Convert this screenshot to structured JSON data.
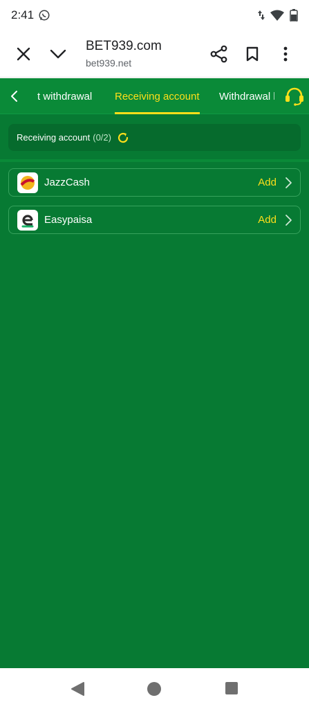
{
  "status_bar": {
    "time": "2:41",
    "icons": [
      "whatsapp-icon",
      "data-arrows-icon",
      "wifi-icon",
      "battery-icon"
    ]
  },
  "browser": {
    "title": "BET939.com",
    "url": "bet939.net",
    "icons": [
      "close-icon",
      "chevron-down-icon",
      "share-icon",
      "bookmark-icon",
      "more-vert-icon"
    ]
  },
  "tabs": {
    "items": [
      {
        "label": "t withdrawal",
        "active": false
      },
      {
        "label": "Receiving account",
        "active": true
      },
      {
        "label": "Withdrawal l",
        "active": false
      }
    ],
    "back_icon": "chevron-left-icon",
    "support_icon": "headset-icon"
  },
  "summary": {
    "label": "Receiving account",
    "count": "(0/2)",
    "refresh_icon": "refresh-icon"
  },
  "accounts": [
    {
      "name": "JazzCash",
      "action": "Add",
      "logo": "jazzcash-logo"
    },
    {
      "name": "Easypaisa",
      "action": "Add",
      "logo": "easypaisa-logo"
    }
  ],
  "colors": {
    "green_bg": "#077a33",
    "tab_bg": "#0a8a38",
    "accent_yellow": "#ffdf1a"
  },
  "nav": {
    "icons": [
      "back-triangle-icon",
      "home-circle-icon",
      "recents-square-icon"
    ]
  }
}
